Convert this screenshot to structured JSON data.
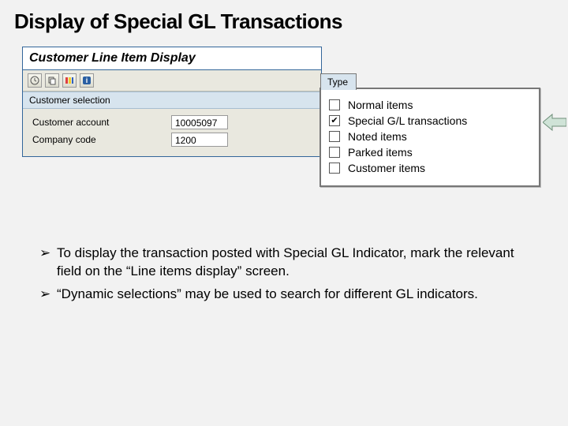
{
  "slide": {
    "title": "Display of Special GL Transactions"
  },
  "sap_panel": {
    "title": "Customer Line Item Display",
    "section_label": "Customer selection",
    "rows": [
      {
        "label": "Customer account",
        "value": "10005097"
      },
      {
        "label": "Company code",
        "value": "1200"
      }
    ]
  },
  "type_panel": {
    "tab": "Type",
    "items": [
      {
        "label": "Normal items",
        "checked": false
      },
      {
        "label": "Special G/L transactions",
        "checked": true
      },
      {
        "label": "Noted items",
        "checked": false
      },
      {
        "label": "Parked items",
        "checked": false
      },
      {
        "label": "Customer items",
        "checked": false
      }
    ]
  },
  "bullets": [
    "To display the transaction posted with Special GL Indicator, mark the relevant field on the “Line items display” screen.",
    "“Dynamic selections” may be used to search for different GL indicators."
  ]
}
